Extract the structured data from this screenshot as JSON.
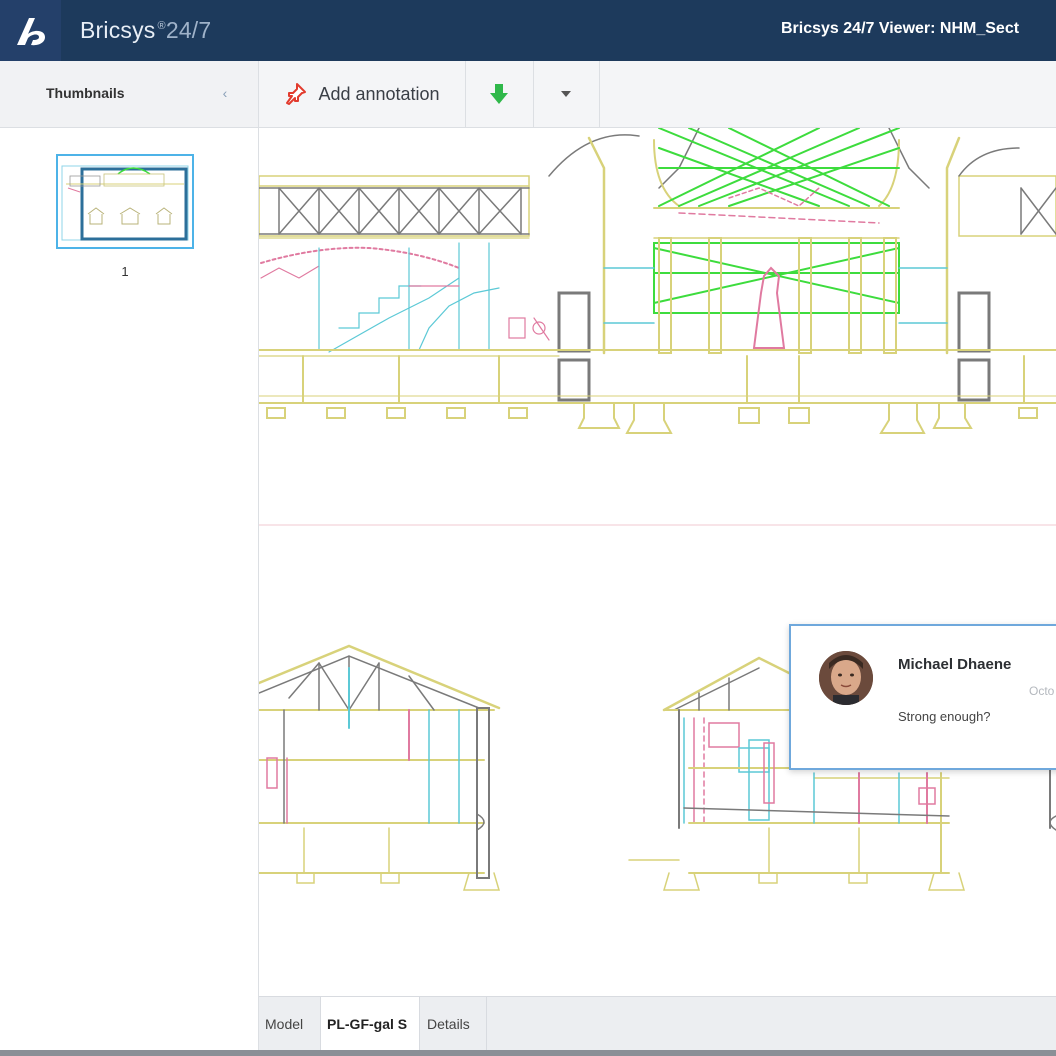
{
  "app": {
    "brand_name": "Bricsys",
    "brand_version": "24/7",
    "brand_mark": "®",
    "viewer_title": "Bricsys 24/7 Viewer: NHM_Sect"
  },
  "sidebar": {
    "title": "Thumbnails",
    "collapse_glyph": "‹",
    "thumbnails": [
      {
        "page": "1"
      }
    ]
  },
  "toolbar": {
    "add_annotation_label": "Add annotation",
    "icons": {
      "annotation": "pin-icon",
      "download": "download-arrow-icon",
      "dropdown": "caret-down-icon"
    }
  },
  "comment": {
    "author": "Michael Dhaene",
    "date": "Octo",
    "text": "Strong enough?"
  },
  "tabs": [
    {
      "label": "Model",
      "active": false
    },
    {
      "label": "PL-GF-gal S",
      "active": true
    },
    {
      "label": "Details",
      "active": false
    }
  ],
  "colors": {
    "topbar": "#1d3a5c",
    "accent": "#4db3e8",
    "drawing_yellow": "#d8d27a",
    "drawing_cyan": "#5cc9d6",
    "drawing_green": "#3ddc3d",
    "drawing_pink": "#e07aa0",
    "drawing_gray": "#7a7a7a"
  }
}
